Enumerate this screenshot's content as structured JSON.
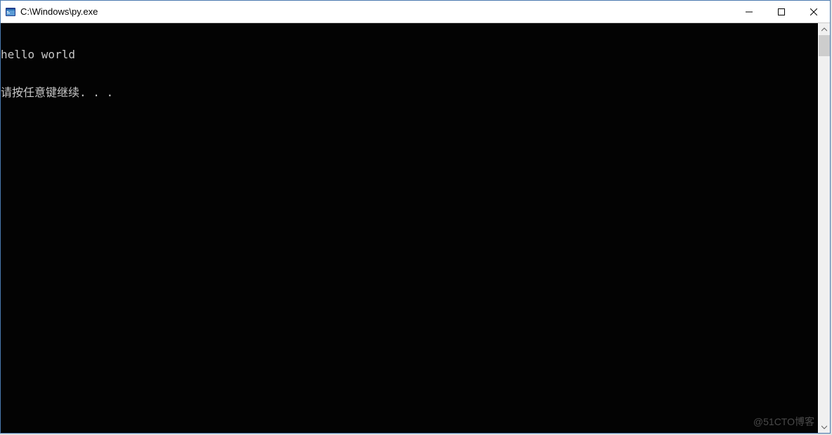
{
  "window": {
    "title": "C:\\Windows\\py.exe"
  },
  "console": {
    "lines": [
      "hello world",
      "请按任意键继续. . ."
    ]
  },
  "watermark": "@51CTO博客"
}
